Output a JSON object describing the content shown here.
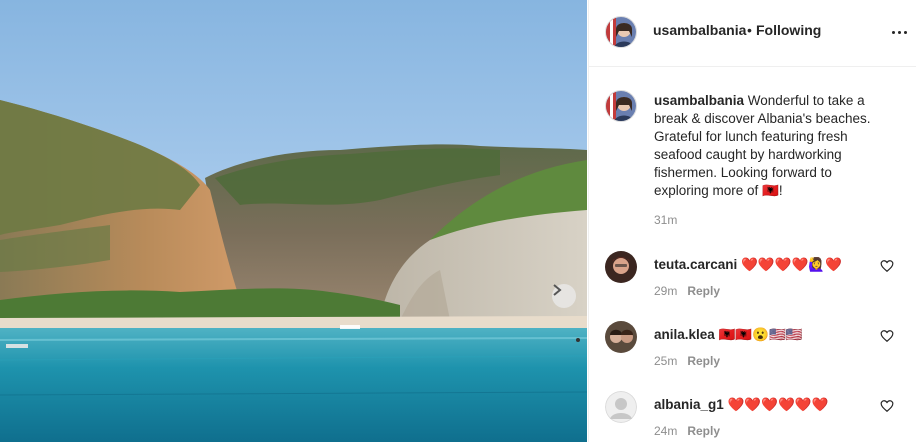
{
  "post": {
    "author": "usambalbania",
    "follow_separator": "•",
    "follow_status": "Following",
    "more_icon": "more-horizontal-icon",
    "next_icon": "chevron-right-icon",
    "photo_description": ""
  },
  "caption": {
    "username": "usambalbania",
    "text": "Wonderful to take a break & discover Albania's beaches. Grateful for lunch featuring fresh seafood caught by hardworking fishermen. Looking forward to exploring more of 🇦🇱!",
    "time": "31m"
  },
  "comments": [
    {
      "username": "teuta.carcani",
      "text": "❤️❤️❤️❤️🙋‍♀️❤️",
      "time": "29m",
      "reply_label": "Reply"
    },
    {
      "username": "anila.klea",
      "text": "🇦🇱🇦🇱😮🇺🇸🇺🇸",
      "time": "25m",
      "reply_label": "Reply"
    },
    {
      "username": "albania_g1",
      "text": "❤️❤️❤️❤️❤️❤️",
      "time": "24m",
      "reply_label": "Reply"
    }
  ],
  "colors": {
    "accent_text": "#262626",
    "muted_text": "#8e8e8e",
    "divider": "#efefef",
    "sea": "#1f8fa6",
    "sky": "#9cc3e8"
  }
}
